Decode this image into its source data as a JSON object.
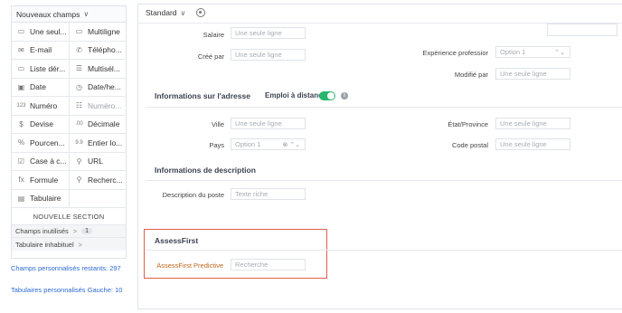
{
  "palette": {
    "header": "Nouveaux champs",
    "items": [
      {
        "icon": "single-line-icon",
        "glyph": "▭",
        "label": "Une seul..."
      },
      {
        "icon": "multiline-icon",
        "glyph": "▭",
        "label": "Multiligne"
      },
      {
        "icon": "email-icon",
        "glyph": "✉",
        "label": "E-mail"
      },
      {
        "icon": "phone-icon",
        "glyph": "✆",
        "label": "Télépho..."
      },
      {
        "icon": "picklist-icon",
        "glyph": "▭",
        "label": "Liste dér..."
      },
      {
        "icon": "multiselect-icon",
        "glyph": "☰",
        "label": "Multisél..."
      },
      {
        "icon": "date-icon",
        "glyph": "▣",
        "label": "Date"
      },
      {
        "icon": "datetime-icon",
        "glyph": "◷",
        "label": "Date/he..."
      },
      {
        "icon": "number-icon",
        "glyph": "123",
        "label": "Numéro"
      },
      {
        "icon": "autonumber-icon",
        "glyph": "☷",
        "label": "Numéro..."
      },
      {
        "icon": "currency-icon",
        "glyph": "$",
        "label": "Devise"
      },
      {
        "icon": "decimal-icon",
        "glyph": ".00",
        "label": "Décimale"
      },
      {
        "icon": "percent-icon",
        "glyph": "%",
        "label": "Pourcen..."
      },
      {
        "icon": "long-integer-icon",
        "glyph": "9.9",
        "label": "Entier lo..."
      },
      {
        "icon": "checkbox-icon",
        "glyph": "☑",
        "label": "Case à c..."
      },
      {
        "icon": "url-icon",
        "glyph": "⚲",
        "label": "URL"
      },
      {
        "icon": "formula-icon",
        "glyph": "fx",
        "label": "Formule"
      },
      {
        "icon": "lookup-icon",
        "glyph": "⚲",
        "label": "Recherc..."
      },
      {
        "icon": "subform-icon",
        "glyph": "▤",
        "label": "Tabulaire"
      }
    ],
    "new_section": "NOUVELLE SECTION",
    "unused_fields": "Champs inutilisés",
    "unused_count": "1",
    "inactive_subforms": "Tabulaire inhabituel",
    "remaining_fields": "Champs personnalisés restants: 297",
    "remaining_subforms": "Tabulaires personnalisés Gauche: 10"
  },
  "toolbar": {
    "layout": "Standard"
  },
  "form": {
    "salary": {
      "label": "Salaire",
      "placeholder": "Une seule ligne"
    },
    "created_by": {
      "label": "Créé par",
      "placeholder": "Une seule ligne"
    },
    "experience": {
      "label": "Expérience professior",
      "placeholder": "Option 1",
      "suffix": "⌃⌄"
    },
    "modified_by": {
      "label": "Modifié par",
      "placeholder": "Une seule ligne"
    },
    "address_section": {
      "title": "Informations sur l'adresse",
      "remote_label": "Emploi à distance"
    },
    "city": {
      "label": "Ville",
      "placeholder": "Une seule ligne"
    },
    "state": {
      "label": "État/Province",
      "placeholder": "Une seule ligne"
    },
    "country": {
      "label": "Pays",
      "placeholder": "Option 1",
      "suffix": "⊗ ⌃⌄"
    },
    "postal_code": {
      "label": "Code postal",
      "placeholder": "Une seule ligne"
    },
    "description_section": {
      "title": "Informations de description"
    },
    "job_description": {
      "label": "Description du poste",
      "placeholder": "Texte riche"
    },
    "assessfirst_section": {
      "title": "AssessFirst"
    },
    "assessfirst_predictive": {
      "label": "AssessFirst Predictive",
      "placeholder": "Recherche"
    }
  }
}
